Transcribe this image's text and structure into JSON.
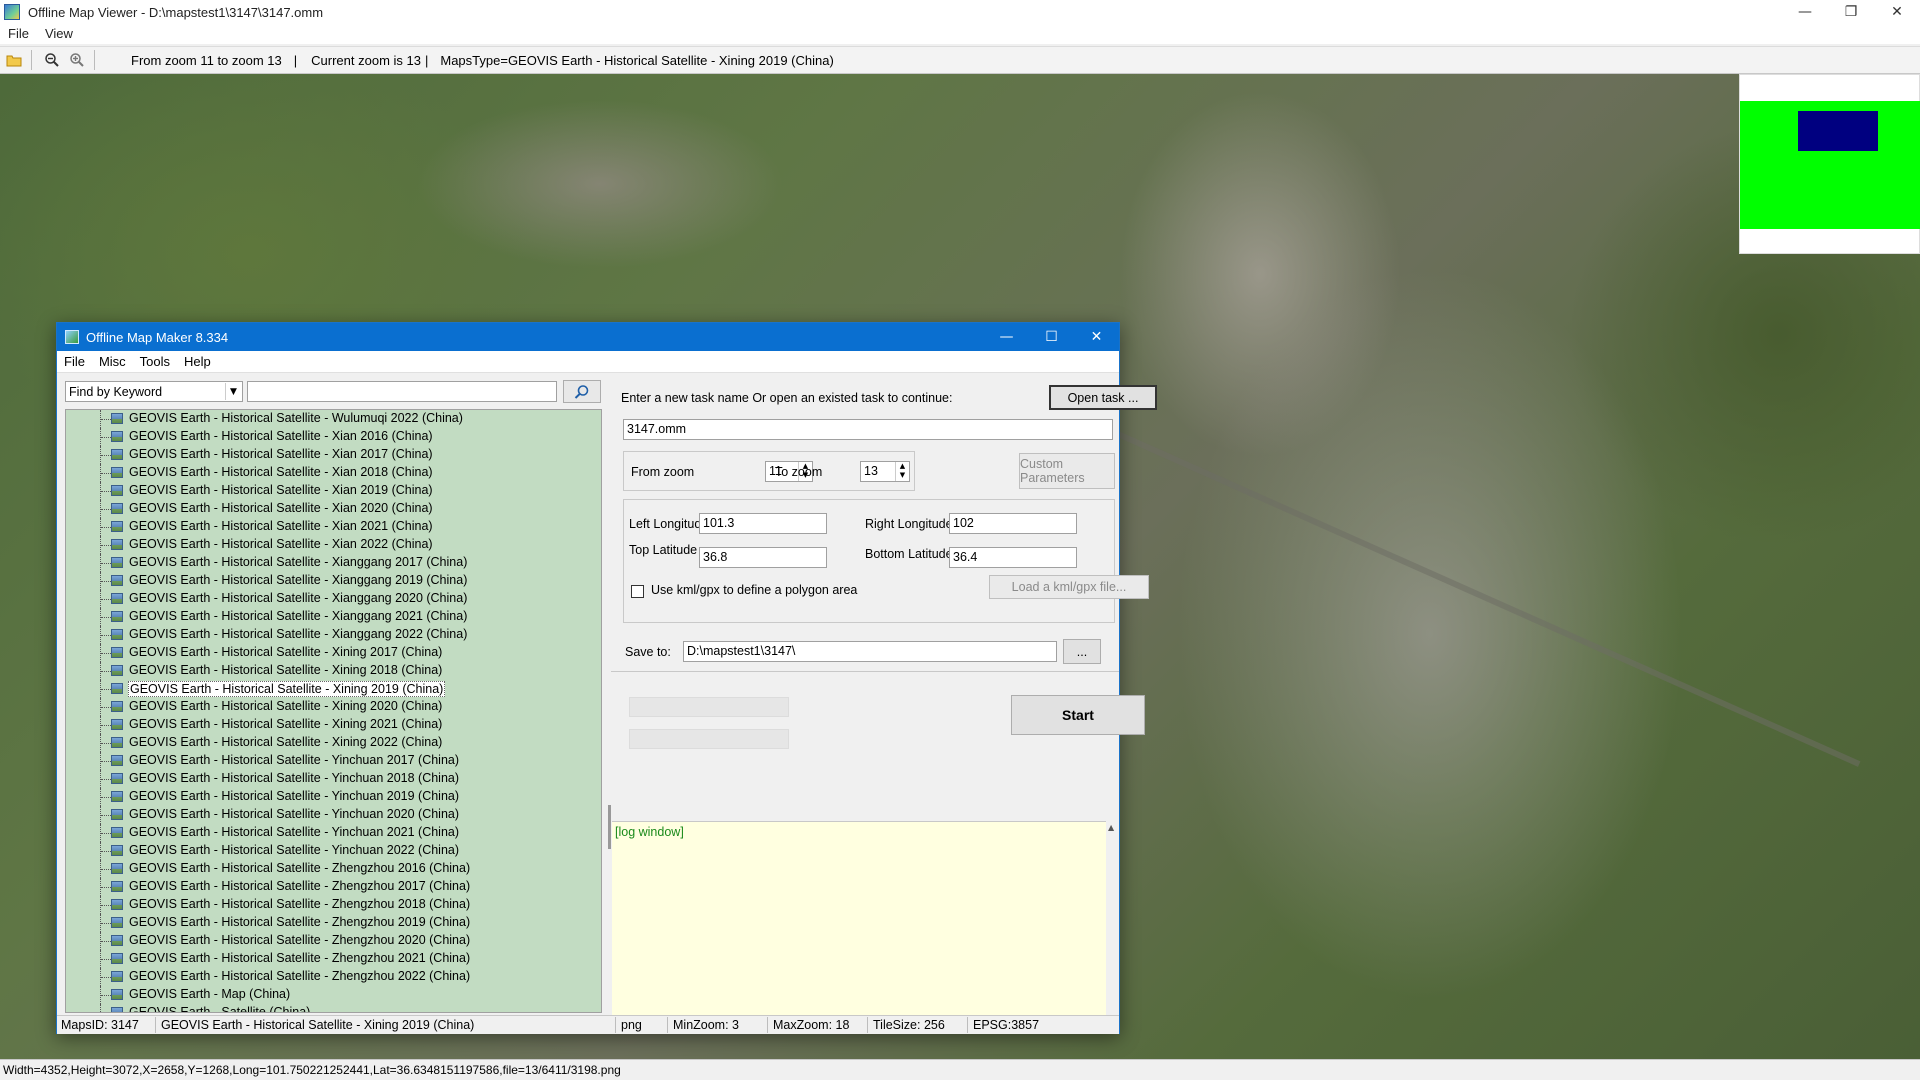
{
  "viewer": {
    "title": "Offline Map Viewer - D:\\mapstest1\\3147\\3147.omm",
    "menu": [
      "File",
      "View"
    ],
    "toolbar": {
      "zoom_range": "From zoom 11 to zoom 13",
      "current_zoom": "Current zoom is 13",
      "maps_type": "MapsType=GEOVIS Earth - Historical Satellite - Xining 2019 (China)"
    },
    "status": "Width=4352,Height=3072,X=2658,Y=1268,Long=101.750221252441,Lat=36.6348151197586,file=13/6411/3198.png",
    "icons": [
      "open-folder-icon",
      "zoom-out-icon",
      "zoom-in-icon"
    ]
  },
  "maker": {
    "title": "Offline Map Maker 8.334",
    "menu": [
      "File",
      "Misc",
      "Tools",
      "Help"
    ],
    "find_by": "Find by Keyword",
    "keyword": "",
    "map_list": [
      "GEOVIS Earth - Historical Satellite - Wulumuqi 2022 (China)",
      "GEOVIS Earth - Historical Satellite - Xian 2016 (China)",
      "GEOVIS Earth - Historical Satellite - Xian 2017 (China)",
      "GEOVIS Earth - Historical Satellite - Xian 2018 (China)",
      "GEOVIS Earth - Historical Satellite - Xian 2019 (China)",
      "GEOVIS Earth - Historical Satellite - Xian 2020 (China)",
      "GEOVIS Earth - Historical Satellite - Xian 2021 (China)",
      "GEOVIS Earth - Historical Satellite - Xian 2022 (China)",
      "GEOVIS Earth - Historical Satellite - Xianggang 2017 (China)",
      "GEOVIS Earth - Historical Satellite - Xianggang 2019 (China)",
      "GEOVIS Earth - Historical Satellite - Xianggang 2020 (China)",
      "GEOVIS Earth - Historical Satellite - Xianggang 2021 (China)",
      "GEOVIS Earth - Historical Satellite - Xianggang 2022 (China)",
      "GEOVIS Earth - Historical Satellite - Xining 2017 (China)",
      "GEOVIS Earth - Historical Satellite - Xining 2018 (China)",
      "GEOVIS Earth - Historical Satellite - Xining 2019 (China)",
      "GEOVIS Earth - Historical Satellite - Xining 2020 (China)",
      "GEOVIS Earth - Historical Satellite - Xining 2021 (China)",
      "GEOVIS Earth - Historical Satellite - Xining 2022 (China)",
      "GEOVIS Earth - Historical Satellite - Yinchuan 2017 (China)",
      "GEOVIS Earth - Historical Satellite - Yinchuan 2018 (China)",
      "GEOVIS Earth - Historical Satellite - Yinchuan 2019 (China)",
      "GEOVIS Earth - Historical Satellite - Yinchuan 2020 (China)",
      "GEOVIS Earth - Historical Satellite - Yinchuan 2021 (China)",
      "GEOVIS Earth - Historical Satellite - Yinchuan 2022 (China)",
      "GEOVIS Earth - Historical Satellite - Zhengzhou 2016 (China)",
      "GEOVIS Earth - Historical Satellite - Zhengzhou 2017 (China)",
      "GEOVIS Earth - Historical Satellite - Zhengzhou 2018 (China)",
      "GEOVIS Earth - Historical Satellite - Zhengzhou 2019 (China)",
      "GEOVIS Earth - Historical Satellite - Zhengzhou 2020 (China)",
      "GEOVIS Earth - Historical Satellite - Zhengzhou 2021 (China)",
      "GEOVIS Earth - Historical Satellite - Zhengzhou 2022 (China)",
      "GEOVIS Earth - Map (China)",
      "GEOVIS Earth - Satellite (China)"
    ],
    "selected_index": 15,
    "task": {
      "prompt": "Enter a new task name Or open an existed task to continue:",
      "open_label": "Open task ...",
      "name": "3147.omm"
    },
    "zoom": {
      "from_label": "From zoom",
      "from_value": "11",
      "to_label": "To zoom",
      "to_value": "13",
      "custom_label": "Custom Parameters"
    },
    "area": {
      "left_lon_label": "Left Longitude",
      "left_lon": "101.3",
      "right_lon_label": "Right Longitude",
      "right_lon": "102",
      "top_lat_label": "Top Latitude",
      "top_lat": "36.8",
      "bottom_lat_label": "Bottom Latitude",
      "bottom_lat": "36.4",
      "kml_label": "Use kml/gpx to define a polygon area",
      "load_kml_label": "Load a kml/gpx file..."
    },
    "save": {
      "label": "Save to:",
      "path": "D:\\mapstest1\\3147\\",
      "browse_label": "..."
    },
    "start_label": "Start",
    "log_text": "[log window]",
    "status": {
      "maps_id": "MapsID: 3147",
      "map_name": "GEOVIS Earth - Historical Satellite - Xining 2019 (China)",
      "format": "png",
      "min_zoom": "MinZoom: 3",
      "max_zoom": "MaxZoom: 18",
      "tile_size": "TileSize: 256",
      "epsg": "EPSG:3857"
    }
  }
}
